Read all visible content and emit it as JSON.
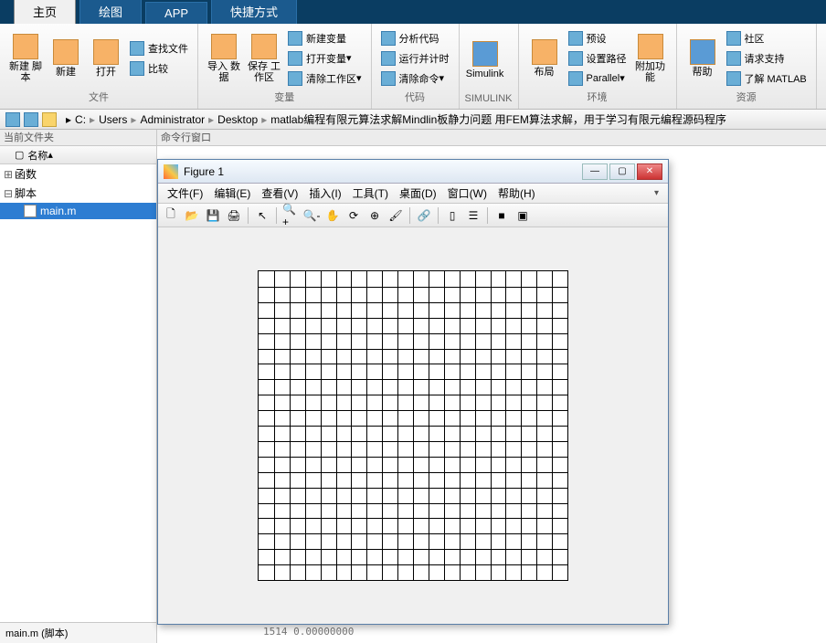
{
  "tabs": {
    "home": "主页",
    "plots": "绘图",
    "apps": "APP",
    "shortcuts": "快捷方式"
  },
  "ribbon": {
    "file_group": "文件",
    "var_group": "变量",
    "code_group": "代码",
    "simulink_group": "SIMULINK",
    "env_group": "环境",
    "res_group": "资源",
    "new_script": "新建\n脚本",
    "new": "新建",
    "open": "打开",
    "find_files": "查找文件",
    "compare": "比较",
    "import": "导入\n数据",
    "save_ws": "保存\n工作区",
    "new_var": "新建变量",
    "open_var": "打开变量",
    "clear_ws": "清除工作区",
    "analyze": "分析代码",
    "run_time": "运行并计时",
    "clear_cmd": "清除命令",
    "simulink": "Simulink",
    "layout": "布局",
    "preset": "预设",
    "set_path": "设置路径",
    "parallel": "Parallel",
    "addons": "附加功能",
    "help": "帮助",
    "community": "社区",
    "support": "请求支持",
    "learn": "了解 MATLAB"
  },
  "breadcrumb": [
    "C:",
    "Users",
    "Administrator",
    "Desktop",
    "matlab编程有限元算法求解Mindlin板静力问题 用FEM算法求解，用于学习有限元编程源码程序"
  ],
  "panels": {
    "current_folder": "当前文件夹",
    "command_window": "命令行窗口",
    "name_col": "名称"
  },
  "tree": {
    "functions": "函数",
    "scripts": "脚本",
    "file": "main.m"
  },
  "status": "main.m (脚本)",
  "result_line": "1514    0.00000000",
  "figure": {
    "title": "Figure 1",
    "menu": {
      "file": "文件(F)",
      "edit": "编辑(E)",
      "view": "查看(V)",
      "insert": "插入(I)",
      "tools": "工具(T)",
      "desktop": "桌面(D)",
      "window": "窗口(W)",
      "help": "帮助(H)"
    }
  },
  "chart_data": {
    "type": "heatmap",
    "description": "20x20 uniform square mesh grid (FEM Mindlin plate mesh)",
    "nx": 20,
    "ny": 20,
    "xlim": [
      0,
      1
    ],
    "ylim": [
      0,
      1
    ]
  }
}
